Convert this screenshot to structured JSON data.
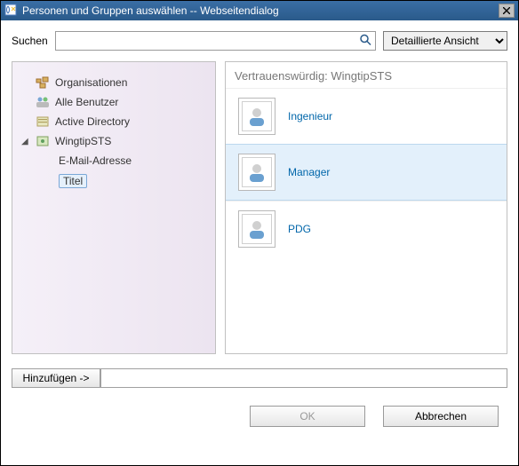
{
  "window": {
    "title": "Personen und Gruppen auswählen -- Webseitendialog"
  },
  "search": {
    "label": "Suchen",
    "value": "",
    "placeholder": ""
  },
  "view_select": {
    "selected": "Detaillierte Ansicht"
  },
  "tree": {
    "items": [
      {
        "label": "Organisationen"
      },
      {
        "label": "Alle Benutzer"
      },
      {
        "label": "Active Directory"
      },
      {
        "label": "WingtipSTS",
        "expanded": true,
        "children": [
          {
            "label": "E-Mail-Adresse"
          },
          {
            "label": "Titel",
            "selected": true
          }
        ]
      }
    ]
  },
  "results": {
    "header": "Vertrauenswürdig: WingtipSTS",
    "items": [
      {
        "label": "Ingenieur",
        "selected": false
      },
      {
        "label": "Manager",
        "selected": true
      },
      {
        "label": "PDG",
        "selected": false
      }
    ]
  },
  "add": {
    "button": "Hinzufügen ->",
    "value": ""
  },
  "footer": {
    "ok": "OK",
    "cancel": "Abbrechen"
  }
}
